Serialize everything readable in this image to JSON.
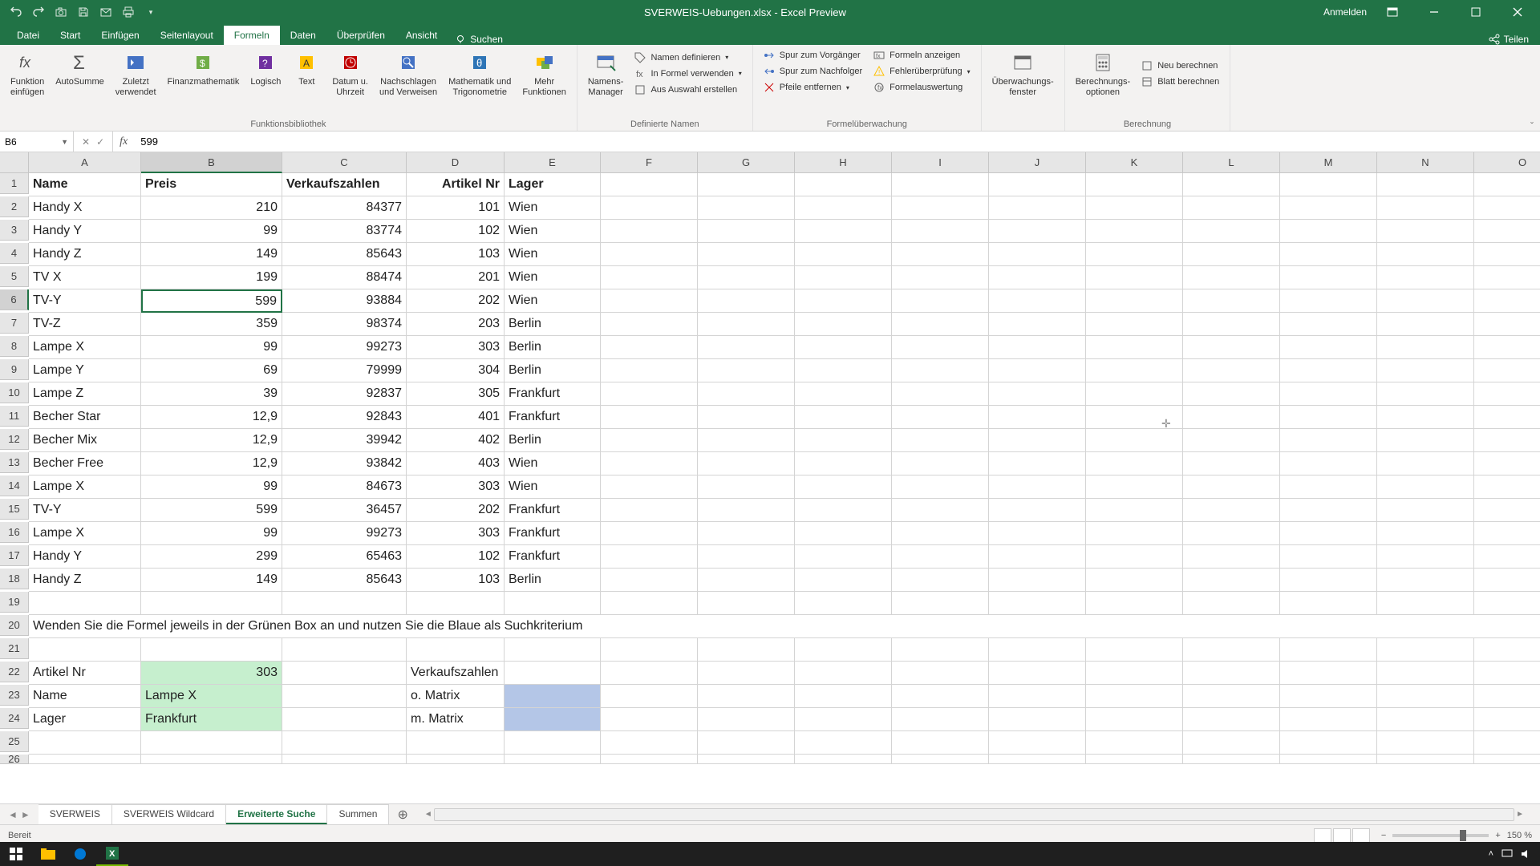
{
  "window": {
    "title": "SVERWEIS-Uebungen.xlsx - Excel Preview",
    "anmelden": "Anmelden"
  },
  "tabs": {
    "datei": "Datei",
    "start": "Start",
    "einfuegen": "Einfügen",
    "seitenlayout": "Seitenlayout",
    "formeln": "Formeln",
    "daten": "Daten",
    "ueberpruefen": "Überprüfen",
    "ansicht": "Ansicht",
    "suchen": "Suchen",
    "teilen": "Teilen"
  },
  "ribbon": {
    "funktion_einfuegen": "Funktion\neinfügen",
    "autosumme": "AutoSumme",
    "zuletzt": "Zuletzt\nverwendet",
    "finanz": "Finanzmathematik",
    "logisch": "Logisch",
    "text": "Text",
    "datum": "Datum u.\nUhrzeit",
    "nachschlagen": "Nachschlagen\nund Verweisen",
    "mathematik": "Mathematik und\nTrigonometrie",
    "mehr": "Mehr\nFunktionen",
    "grp_fbib": "Funktionsbibliothek",
    "namens_manager": "Namens-\nManager",
    "namen_def": "Namen definieren",
    "in_formel": "In Formel verwenden",
    "aus_auswahl": "Aus Auswahl erstellen",
    "grp_namen": "Definierte Namen",
    "spur_vor": "Spur zum Vorgänger",
    "spur_nach": "Spur zum Nachfolger",
    "pfeile": "Pfeile entfernen",
    "formeln_anz": "Formeln anzeigen",
    "fehler": "Fehlerüberprüfung",
    "formelaus": "Formelauswertung",
    "grp_ueberwachung": "Formelüberwachung",
    "ueberwachungs": "Überwachungs-\nfenster",
    "berechnungs_opt": "Berechnungs-\noptionen",
    "neu_berechnen": "Neu berechnen",
    "blatt_berechnen": "Blatt berechnen",
    "grp_berechnung": "Berechnung"
  },
  "namebox": "B6",
  "formula": "599",
  "columns": [
    "A",
    "B",
    "C",
    "D",
    "E",
    "F",
    "G",
    "H",
    "I",
    "J",
    "K",
    "L",
    "M",
    "N",
    "O"
  ],
  "headers": {
    "name": "Name",
    "preis": "Preis",
    "verkauf": "Verkaufszahlen",
    "artikel": "Artikel Nr",
    "lager": "Lager"
  },
  "rows": [
    {
      "n": "Handy X",
      "p": "210",
      "v": "84377",
      "a": "101",
      "l": "Wien"
    },
    {
      "n": "Handy Y",
      "p": "99",
      "v": "83774",
      "a": "102",
      "l": "Wien"
    },
    {
      "n": "Handy Z",
      "p": "149",
      "v": "85643",
      "a": "103",
      "l": "Wien"
    },
    {
      "n": "TV X",
      "p": "199",
      "v": "88474",
      "a": "201",
      "l": "Wien"
    },
    {
      "n": "TV-Y",
      "p": "599",
      "v": "93884",
      "a": "202",
      "l": "Wien"
    },
    {
      "n": "TV-Z",
      "p": "359",
      "v": "98374",
      "a": "203",
      "l": "Berlin"
    },
    {
      "n": "Lampe X",
      "p": "99",
      "v": "99273",
      "a": "303",
      "l": "Berlin"
    },
    {
      "n": "Lampe Y",
      "p": "69",
      "v": "79999",
      "a": "304",
      "l": "Berlin"
    },
    {
      "n": "Lampe Z",
      "p": "39",
      "v": "92837",
      "a": "305",
      "l": "Frankfurt"
    },
    {
      "n": "Becher Star",
      "p": "12,9",
      "v": "92843",
      "a": "401",
      "l": "Frankfurt"
    },
    {
      "n": "Becher Mix",
      "p": "12,9",
      "v": "39942",
      "a": "402",
      "l": "Berlin"
    },
    {
      "n": "Becher Free",
      "p": "12,9",
      "v": "93842",
      "a": "403",
      "l": "Wien"
    },
    {
      "n": "Lampe X",
      "p": "99",
      "v": "84673",
      "a": "303",
      "l": "Wien"
    },
    {
      "n": "TV-Y",
      "p": "599",
      "v": "36457",
      "a": "202",
      "l": "Frankfurt"
    },
    {
      "n": "Lampe X",
      "p": "99",
      "v": "99273",
      "a": "303",
      "l": "Frankfurt"
    },
    {
      "n": "Handy Y",
      "p": "299",
      "v": "65463",
      "a": "102",
      "l": "Frankfurt"
    },
    {
      "n": "Handy Z",
      "p": "149",
      "v": "85643",
      "a": "103",
      "l": "Berlin"
    }
  ],
  "instruction": "Wenden Sie die Formel jeweils in der Grünen Box an und nutzen Sie die Blaue als Suchkriterium",
  "lookup": {
    "artikel_lbl": "Artikel Nr",
    "artikel_val": "303",
    "name_lbl": "Name",
    "name_val": "Lampe X",
    "lager_lbl": "Lager",
    "lager_val": "Frankfurt",
    "verkauf_lbl": "Verkaufszahlen",
    "omatrix": "o. Matrix",
    "mmatrix": "m. Matrix"
  },
  "sheets": {
    "s1": "SVERWEIS",
    "s2": "SVERWEIS Wildcard",
    "s3": "Erweiterte Suche",
    "s4": "Summen"
  },
  "status": {
    "bereit": "Bereit",
    "zoom": "150 %"
  }
}
